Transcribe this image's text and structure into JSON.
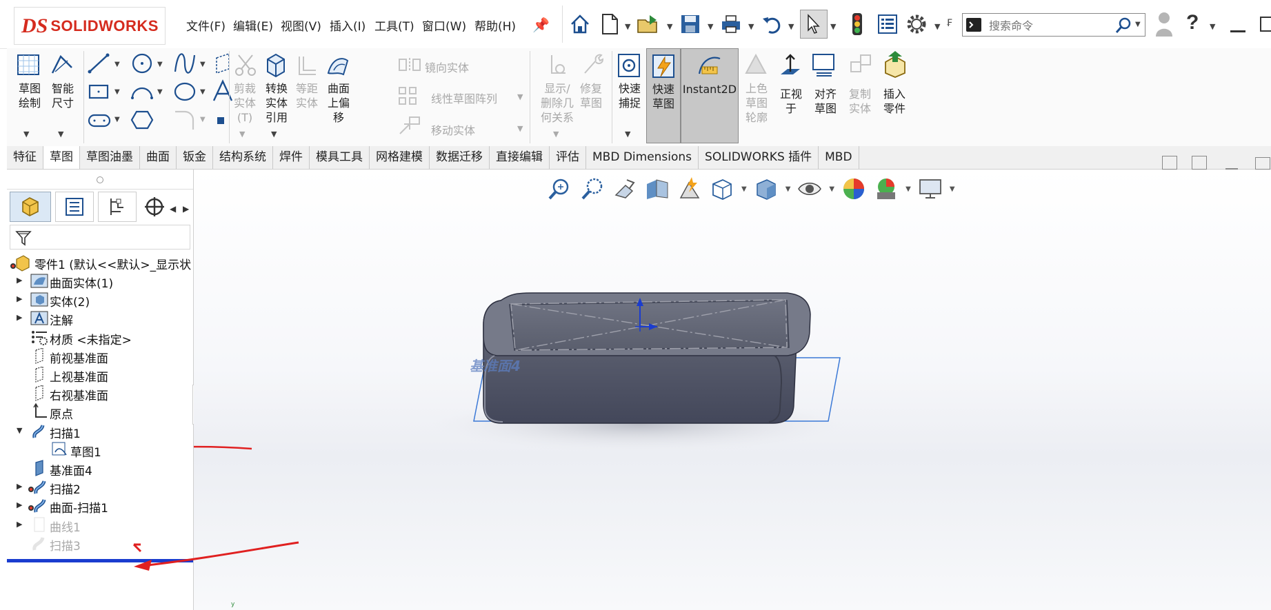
{
  "app": {
    "logo_mark": "DS",
    "logo_text": "SOLIDWORKS"
  },
  "menu": [
    "文件(F)",
    "编辑(E)",
    "视图(V)",
    "插入(I)",
    "工具(T)",
    "窗口(W)",
    "帮助(H)"
  ],
  "search": {
    "placeholder": "搜索命令"
  },
  "toolbar_icons": [
    "home-icon",
    "new-document-icon",
    "open-icon",
    "save-icon",
    "print-icon",
    "undo-icon",
    "select-cursor-icon",
    "rebuild-traffic-light-icon",
    "file-properties-icon",
    "options-gear-icon"
  ],
  "help_label": "?",
  "ribbon": {
    "sketch": [
      "草图",
      "绘制"
    ],
    "smart_dim": [
      "智能",
      "尺寸"
    ],
    "trim": [
      "剪裁",
      "实体",
      "(T)"
    ],
    "convert": [
      "转换",
      "实体",
      "引用"
    ],
    "offset": [
      "等距",
      "实体"
    ],
    "surface_offset": [
      "曲面",
      "上偏",
      "移"
    ],
    "mirror": "镜向实体",
    "linear_pattern": "线性草图阵列",
    "move": "移动实体",
    "display_relations": [
      "显示/",
      "删除几",
      "何关系"
    ],
    "repair": [
      "修复",
      "草图"
    ],
    "quick_snap": [
      "快速",
      "捕捉"
    ],
    "rapid_sketch": [
      "快速",
      "草图"
    ],
    "instant2d": "Instant2D",
    "shaded_contours": [
      "上色",
      "草图",
      "轮廓"
    ],
    "normal_to": [
      "正视",
      "于"
    ],
    "align_sketch": [
      "对齐",
      "草图"
    ],
    "copy_entities": [
      "复制",
      "实体"
    ],
    "insert_part": [
      "插入",
      "零件"
    ]
  },
  "tabs": [
    "特征",
    "草图",
    "草图油墨",
    "曲面",
    "钣金",
    "结构系统",
    "焊件",
    "模具工具",
    "网格建模",
    "数据迁移",
    "直接编辑",
    "评估",
    "MBD Dimensions",
    "SOLIDWORKS 插件",
    "MBD"
  ],
  "active_tab": "草图",
  "tree": {
    "root": "零件1 (默认<<默认>_显示状",
    "items": [
      {
        "label": "曲面实体(1)",
        "expand": "right",
        "dim": false
      },
      {
        "label": "实体(2)",
        "expand": "right",
        "dim": false
      },
      {
        "label": "注解",
        "expand": "right",
        "dim": false
      },
      {
        "label": "材质 <未指定>",
        "expand": "",
        "dim": false
      },
      {
        "label": "前视基准面",
        "expand": "",
        "dim": false
      },
      {
        "label": "上视基准面",
        "expand": "",
        "dim": false
      },
      {
        "label": "右视基准面",
        "expand": "",
        "dim": false
      },
      {
        "label": "原点",
        "expand": "",
        "dim": false
      },
      {
        "label": "扫描1",
        "expand": "down",
        "dim": false
      },
      {
        "label": "草图1",
        "expand": "",
        "dim": false
      },
      {
        "label": "基准面4",
        "expand": "",
        "dim": false
      },
      {
        "label": "扫描2",
        "expand": "right",
        "dim": false
      },
      {
        "label": "曲面-扫描1",
        "expand": "right",
        "dim": false
      },
      {
        "label": "曲线1",
        "expand": "right",
        "dim": true
      },
      {
        "label": "扫描3",
        "expand": "",
        "dim": true
      }
    ]
  },
  "viewport": {
    "plane_label": "基准面4"
  },
  "colors": {
    "accent_blue": "#1a3ccf",
    "arrow_red": "#e02020",
    "part_gray": "#5b606f",
    "logo_red": "#d52b1e"
  }
}
